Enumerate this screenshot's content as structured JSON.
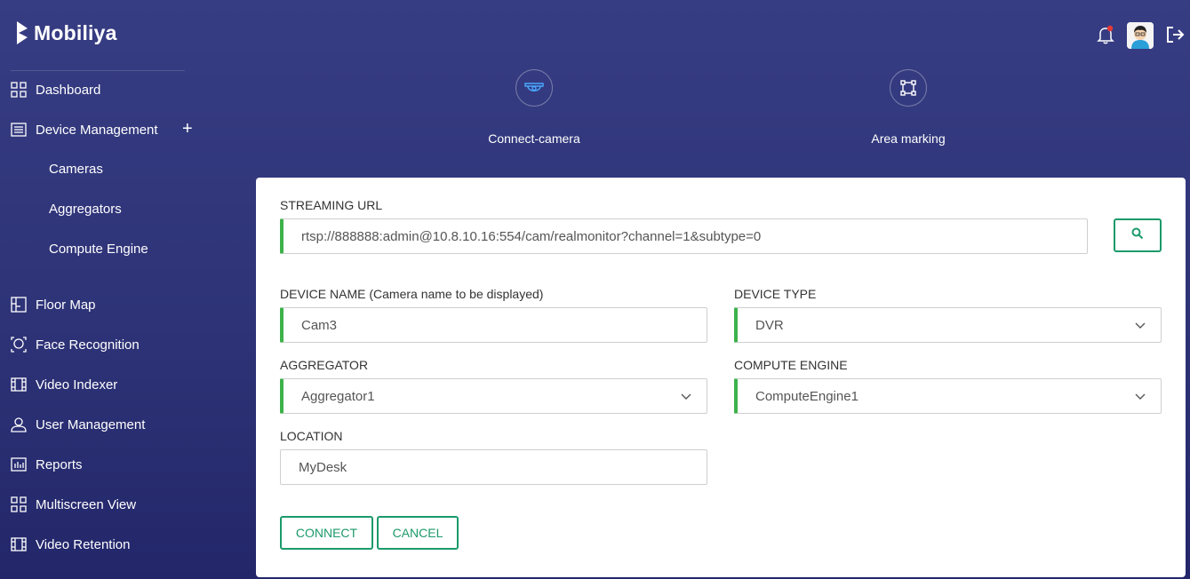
{
  "brand": {
    "name": "Mobiliya"
  },
  "sidebar": {
    "items": [
      {
        "label": "Dashboard",
        "icon": "grid-icon"
      },
      {
        "label": "Device Management",
        "icon": "list-icon"
      },
      {
        "label": "Cameras"
      },
      {
        "label": "Aggregators"
      },
      {
        "label": "Compute Engine"
      },
      {
        "label": "Floor Map",
        "icon": "floor-map-icon"
      },
      {
        "label": "Face Recognition",
        "icon": "face-icon"
      },
      {
        "label": "Video Indexer",
        "icon": "film-icon"
      },
      {
        "label": "User Management",
        "icon": "user-icon"
      },
      {
        "label": "Reports",
        "icon": "chart-icon"
      },
      {
        "label": "Multiscreen View",
        "icon": "grid-icon"
      },
      {
        "label": "Video Retention",
        "icon": "film-icon"
      }
    ],
    "expand_symbol": "+"
  },
  "steps": [
    {
      "label": "Connect-camera",
      "icon": "camera-icon"
    },
    {
      "label": "Area marking",
      "icon": "area-marking-icon"
    }
  ],
  "form": {
    "streaming_url": {
      "label": "STREAMING URL",
      "value": "rtsp://888888:admin@10.8.10.16:554/cam/realmonitor?channel=1&subtype=0"
    },
    "device_name": {
      "label": "DEVICE NAME (Camera name to be displayed)",
      "value": "Cam3"
    },
    "device_type": {
      "label": "DEVICE TYPE",
      "value": "DVR"
    },
    "aggregator": {
      "label": "AGGREGATOR",
      "value": "Aggregator1"
    },
    "compute_engine": {
      "label": "COMPUTE ENGINE",
      "value": "ComputeEngine1"
    },
    "location": {
      "label": "LOCATION",
      "value": "MyDesk"
    },
    "connect_label": "CONNECT",
    "cancel_label": "CANCEL"
  },
  "colors": {
    "accent": "#1c9a6b",
    "valid": "#3db24a",
    "bg": "#2e3377",
    "badge": "#e53935"
  }
}
